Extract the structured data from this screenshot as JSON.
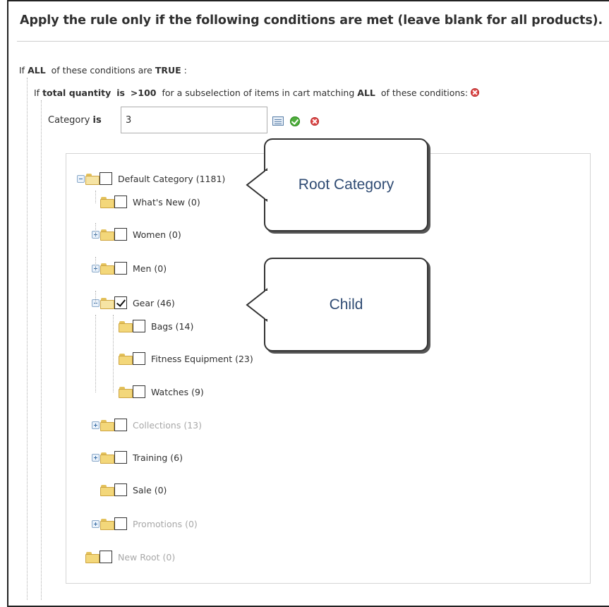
{
  "header": {
    "title": "Apply the rule only if the following conditions are met (leave blank for all products)."
  },
  "conditions": {
    "root": {
      "prefix": "If",
      "aggregator": "ALL",
      "middle": "of these conditions are",
      "value": "TRUE",
      "suffix": ":"
    },
    "subselect": {
      "prefix": "If",
      "attribute": "total quantity",
      "operator": "is",
      "value": ">100",
      "middle": "for a subselection of items in cart matching",
      "aggregator": "ALL",
      "suffix": "of these conditions:"
    },
    "category": {
      "attribute": "Category",
      "operator": "is",
      "value": "3"
    }
  },
  "tree": {
    "nodes": [
      {
        "label": "Default Category (1181)",
        "checked": false,
        "expander": "minus",
        "dim": false
      },
      {
        "label": "What's New (0)",
        "checked": false,
        "expander": "none",
        "dim": false
      },
      {
        "label": "Women (0)",
        "checked": false,
        "expander": "plus",
        "dim": false
      },
      {
        "label": "Men (0)",
        "checked": false,
        "expander": "plus",
        "dim": false
      },
      {
        "label": "Gear (46)",
        "checked": true,
        "expander": "minus",
        "dim": false
      },
      {
        "label": "Bags (14)",
        "checked": false,
        "expander": "none",
        "dim": false
      },
      {
        "label": "Fitness Equipment (23)",
        "checked": false,
        "expander": "none",
        "dim": false
      },
      {
        "label": "Watches (9)",
        "checked": false,
        "expander": "none",
        "dim": false
      },
      {
        "label": "Collections (13)",
        "checked": false,
        "expander": "plus",
        "dim": true
      },
      {
        "label": "Training (6)",
        "checked": false,
        "expander": "plus",
        "dim": false
      },
      {
        "label": "Sale (0)",
        "checked": false,
        "expander": "none",
        "dim": false
      },
      {
        "label": "Promotions (0)",
        "checked": false,
        "expander": "plus",
        "dim": true
      },
      {
        "label": "New Root (0)",
        "checked": false,
        "expander": "none",
        "dim": true
      }
    ]
  },
  "callouts": {
    "root": "Root Category",
    "child": "Child"
  },
  "colors": {
    "remove": "#e04a4a",
    "apply": "#4fae3c",
    "callout_text": "#2f4b73"
  }
}
